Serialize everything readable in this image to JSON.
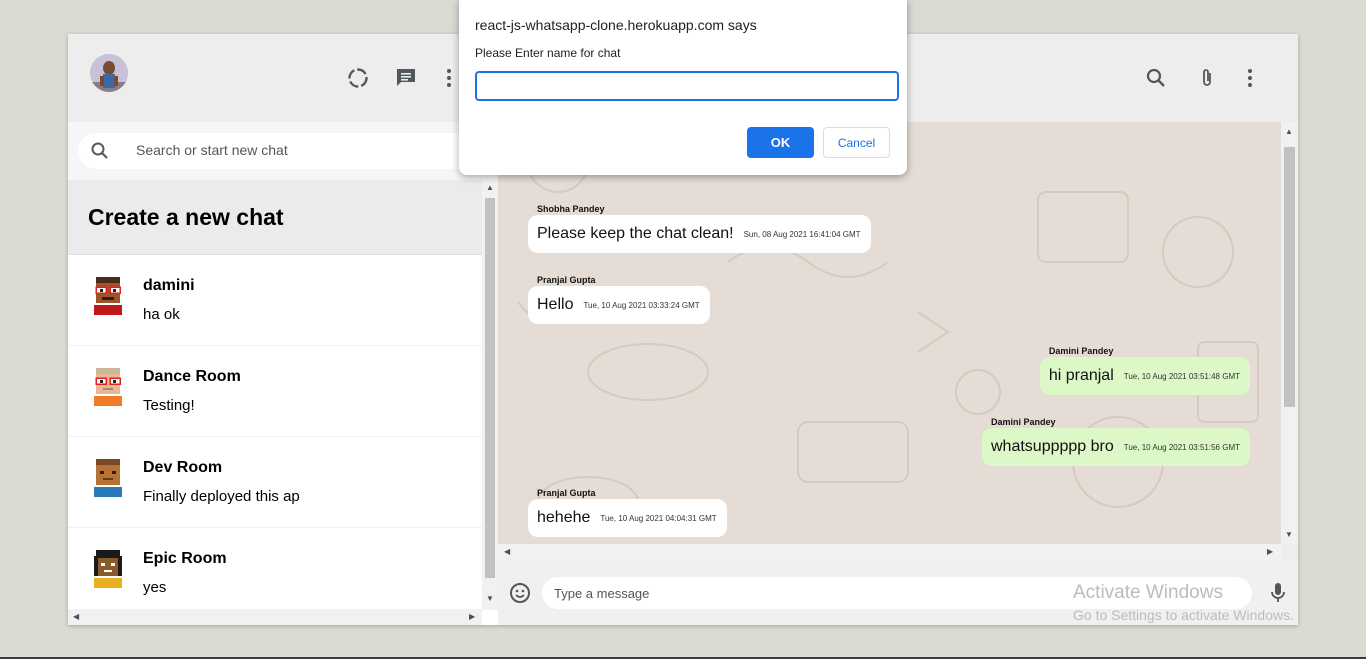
{
  "dialog": {
    "title": "react-js-whatsapp-clone.herokuapp.com says",
    "prompt": "Please Enter name for chat",
    "input_value": "",
    "ok_label": "OK",
    "cancel_label": "Cancel"
  },
  "sidebar": {
    "search_placeholder": "Search or start new chat",
    "create_chat_label": "Create a new chat",
    "chats": [
      {
        "name": "damini",
        "last_message": "ha ok"
      },
      {
        "name": "Dance Room",
        "last_message": "Testing!"
      },
      {
        "name": "Dev Room",
        "last_message": "Finally deployed this ap"
      },
      {
        "name": "Epic Room",
        "last_message": "yes"
      }
    ]
  },
  "messages": [
    {
      "sender": "Shobha Pandey",
      "text": "Please keep the chat clean!",
      "timestamp": "Sun, 08 Aug 2021 16:41:04 GMT",
      "mine": false
    },
    {
      "sender": "Pranjal Gupta",
      "text": "Hello",
      "timestamp": "Tue, 10 Aug 2021 03:33:24 GMT",
      "mine": false
    },
    {
      "sender": "Damini Pandey",
      "text": "hi pranjal",
      "timestamp": "Tue, 10 Aug 2021 03:51:48 GMT",
      "mine": true
    },
    {
      "sender": "Damini Pandey",
      "text": "whatsuppppp bro",
      "timestamp": "Tue, 10 Aug 2021 03:51:56 GMT",
      "mine": true
    },
    {
      "sender": "Pranjal Gupta",
      "text": "hehehe",
      "timestamp": "Tue, 10 Aug 2021 04:04:31 GMT",
      "mine": false
    }
  ],
  "footer": {
    "message_placeholder": "Type a message"
  },
  "watermark": {
    "line1": "Activate Windows",
    "line2": "Go to Settings to activate Windows."
  },
  "icons": {
    "status": "status-icon",
    "new_chat": "chat-icon",
    "menu": "more-vert-icon",
    "search": "search-icon",
    "attach": "attach-icon",
    "emoji": "emoji-icon",
    "mic": "mic-icon"
  },
  "colors": {
    "accent": "#1a73e8",
    "outgoing_bubble": "#dcf8c6",
    "chat_background": "#e5ddd5"
  }
}
